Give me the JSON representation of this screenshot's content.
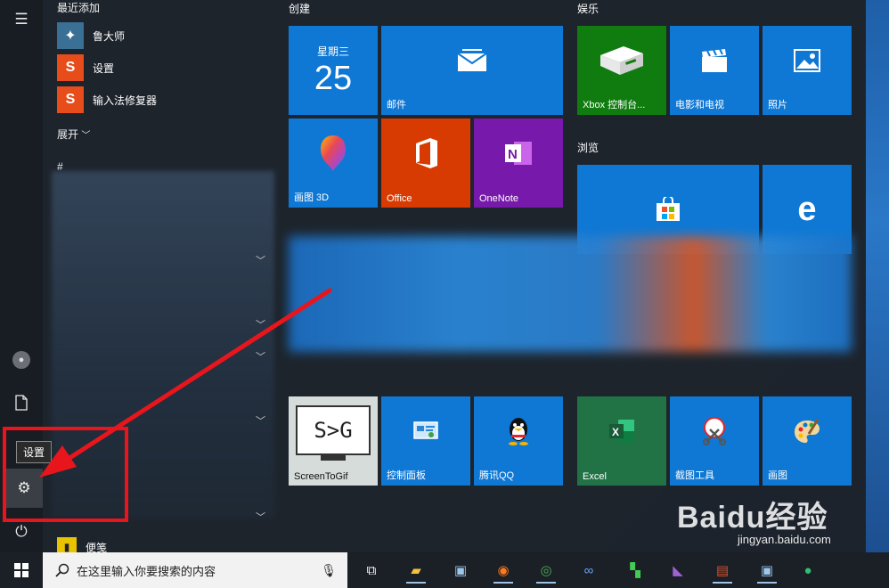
{
  "rail": {
    "tooltip": "设置"
  },
  "applist": {
    "recent_header": "最近添加",
    "recent": [
      {
        "label": "鲁大师",
        "icon": "ludashi-icon",
        "color": "#3a6f96"
      },
      {
        "label": "设置",
        "icon": "sogou-icon",
        "color": "#e74c1b"
      },
      {
        "label": "输入法修复器",
        "icon": "sogou-icon",
        "color": "#e74c1b"
      }
    ],
    "expand_label": "展开",
    "hash_header": "#",
    "bottom_app": "便笺"
  },
  "groups": {
    "create": "创建",
    "entertainment": "娱乐",
    "browse": "浏览"
  },
  "tiles": {
    "calendar_weekday": "星期三",
    "calendar_day": "25",
    "mail": "邮件",
    "paint3d": "画图 3D",
    "office": "Office",
    "onenote": "OneNote",
    "xbox": "Xbox 控制台...",
    "movies": "电影和电视",
    "photos": "照片",
    "screentogif": "ScreenToGif",
    "screentogif_logo": "S>G",
    "control_panel": "控制面板",
    "qq": "腾讯QQ",
    "excel": "Excel",
    "snip": "截图工具",
    "paint": "画图"
  },
  "colors": {
    "tile_blue": "#0f78d4",
    "office_orange": "#d83b01",
    "onenote_purple": "#7719aa",
    "xbox_green": "#107c10",
    "excel_green": "#217346",
    "annotation_red": "#e8161c"
  },
  "taskbar": {
    "search_placeholder": "在这里输入你要搜索的内容"
  },
  "watermark": {
    "brand": "Baidu经验",
    "url": "jingyan.baidu.com"
  }
}
